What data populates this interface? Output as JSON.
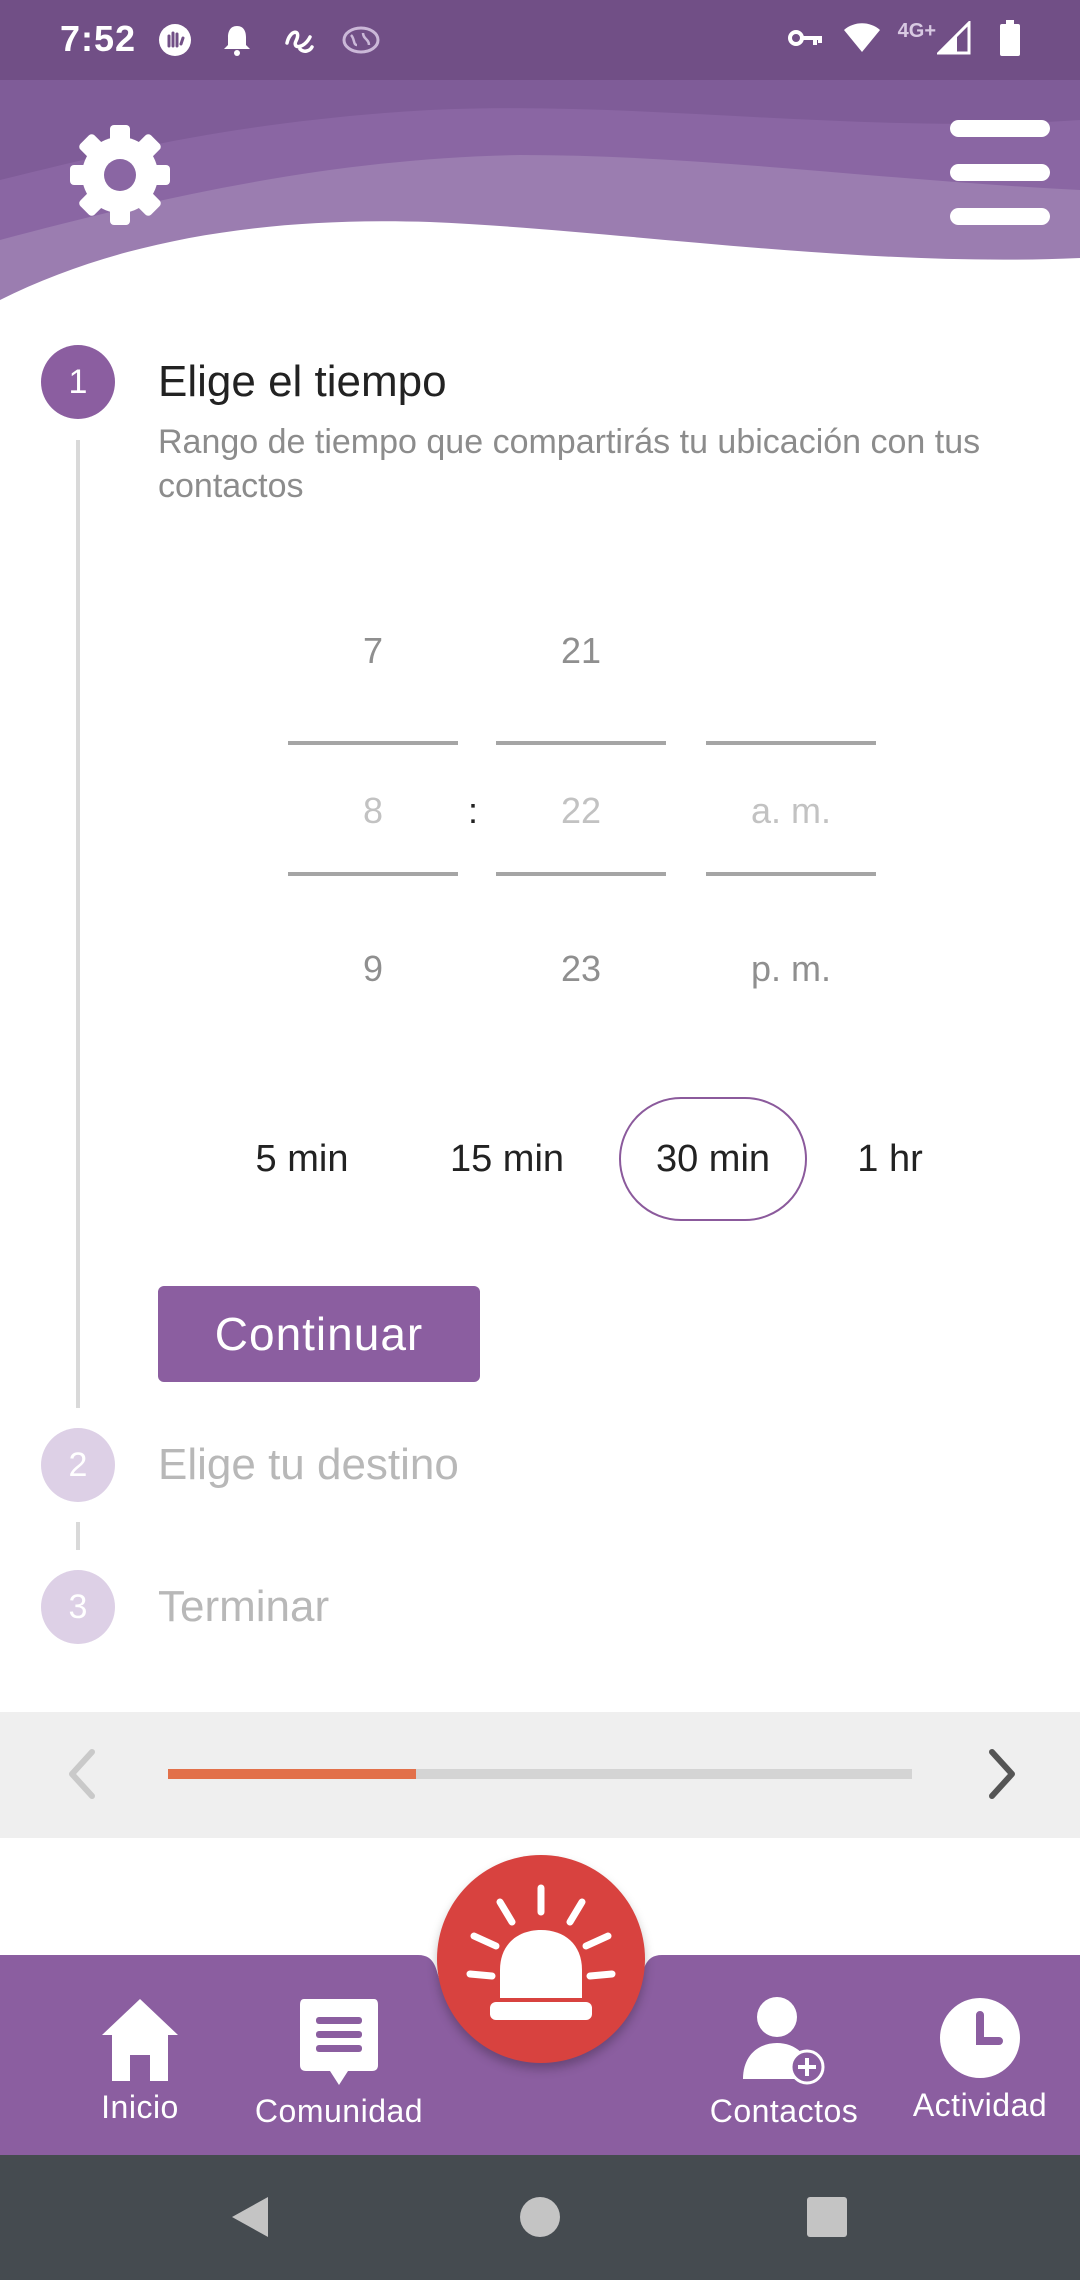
{
  "status_bar": {
    "time": "7:52",
    "network_label": "4G+",
    "left_icons": [
      "hand-icon",
      "bell-icon",
      "squiggle-icon",
      "brain-icon"
    ],
    "right_icons": [
      "key-icon",
      "wifi-icon",
      "signal-icon",
      "battery-icon"
    ]
  },
  "colors": {
    "status_bar": "#714f86",
    "primary": "#8b5ea0",
    "sos": "#d8423f",
    "progress": "#e2704a",
    "system_nav": "#454b50"
  },
  "header": {
    "settings_icon": "gear-icon",
    "menu_icon": "hamburger-menu-icon"
  },
  "steps": [
    {
      "number": "1",
      "title": "Elige el tiempo",
      "subtitle": "Rango de tiempo que compartirás tu ubicación con tus contactos",
      "active": true
    },
    {
      "number": "2",
      "title": "Elige tu destino",
      "active": false
    },
    {
      "number": "3",
      "title": "Terminar",
      "active": false
    }
  ],
  "time_picker": {
    "hours": {
      "prev": "7",
      "selected": "8",
      "next": "9"
    },
    "separator": ":",
    "minutes": {
      "prev": "21",
      "selected": "22",
      "next": "23"
    },
    "period": {
      "prev": "",
      "selected": "a. m.",
      "next": "p. m."
    }
  },
  "quick_options": [
    {
      "label": "5 min",
      "selected": false
    },
    {
      "label": "15 min",
      "selected": false
    },
    {
      "label": "30 min",
      "selected": true
    },
    {
      "label": "1 hr",
      "selected": false
    }
  ],
  "continue_label": "Continuar",
  "pager": {
    "progress_fraction": 0.333
  },
  "bottom_nav": {
    "items": [
      {
        "label": "Inicio",
        "icon": "home-icon"
      },
      {
        "label": "Comunidad",
        "icon": "chat-icon"
      },
      {
        "label": "Contactos",
        "icon": "add-contact-icon"
      },
      {
        "label": "Actividad",
        "icon": "clock-icon"
      }
    ],
    "sos_icon": "siren-icon"
  }
}
